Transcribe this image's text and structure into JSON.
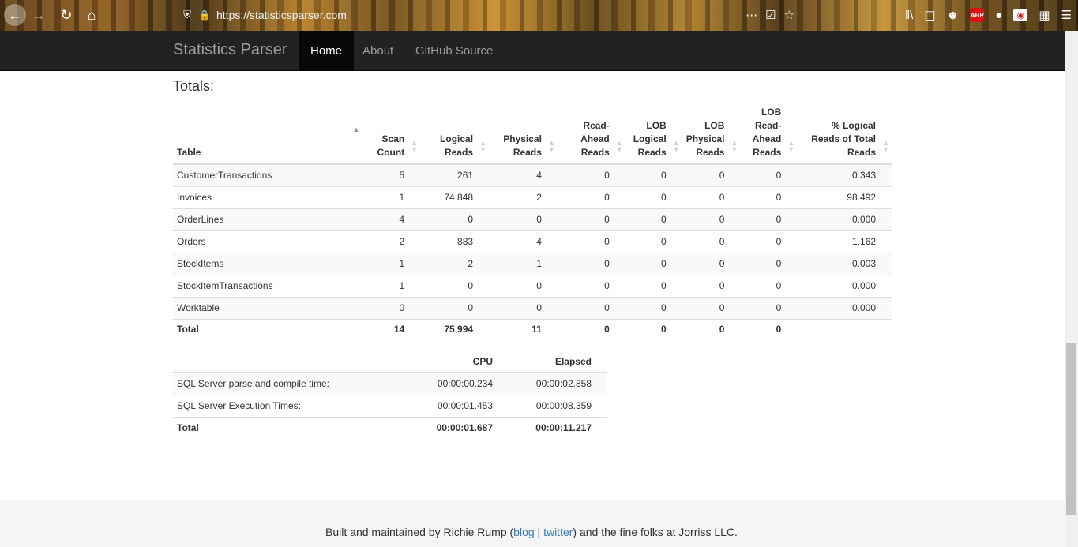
{
  "browser": {
    "url": "https://statisticsparser.com"
  },
  "navbar": {
    "brand": "Statistics Parser",
    "items": [
      {
        "label": "Home",
        "active": true
      },
      {
        "label": "About",
        "active": false
      },
      {
        "label": "GitHub Source",
        "active": false
      }
    ]
  },
  "totals": {
    "heading": "Totals:",
    "columns": [
      "Table",
      "Scan Count",
      "Logical Reads",
      "Physical Reads",
      "Read-Ahead Reads",
      "LOB Logical Reads",
      "LOB Physical Reads",
      "LOB Read-Ahead Reads",
      "% Logical Reads of Total Reads"
    ],
    "rows": [
      [
        "CustomerTransactions",
        "5",
        "261",
        "4",
        "0",
        "0",
        "0",
        "0",
        "0.343"
      ],
      [
        "Invoices",
        "1",
        "74,848",
        "2",
        "0",
        "0",
        "0",
        "0",
        "98.492"
      ],
      [
        "OrderLines",
        "4",
        "0",
        "0",
        "0",
        "0",
        "0",
        "0",
        "0.000"
      ],
      [
        "Orders",
        "2",
        "883",
        "4",
        "0",
        "0",
        "0",
        "0",
        "1.162"
      ],
      [
        "StockItems",
        "1",
        "2",
        "1",
        "0",
        "0",
        "0",
        "0",
        "0.003"
      ],
      [
        "StockItemTransactions",
        "1",
        "0",
        "0",
        "0",
        "0",
        "0",
        "0",
        "0.000"
      ],
      [
        "Worktable",
        "0",
        "0",
        "0",
        "0",
        "0",
        "0",
        "0",
        "0.000"
      ]
    ],
    "total_row": [
      "Total",
      "14",
      "75,994",
      "11",
      "0",
      "0",
      "0",
      "0",
      ""
    ]
  },
  "times": {
    "columns": [
      "",
      "CPU",
      "Elapsed"
    ],
    "rows": [
      [
        "SQL Server parse and compile time:",
        "00:00:00.234",
        "00:00:02.858"
      ],
      [
        "SQL Server Execution Times:",
        "00:00:01.453",
        "00:00:08.359"
      ]
    ],
    "total_row": [
      "Total",
      "00:00:01.687",
      "00:00:11.217"
    ]
  },
  "footer": {
    "prefix": "Built and maintained by Richie Rump (",
    "blog": "blog",
    "sep": " | ",
    "twitter": "twitter",
    "suffix": ") and the fine folks at Jorriss LLC."
  },
  "colors": {
    "navbar_bg": "#222222",
    "nav_active_bg": "#080808",
    "link": "#337ab7",
    "sort_active": "#7a8fc4"
  }
}
